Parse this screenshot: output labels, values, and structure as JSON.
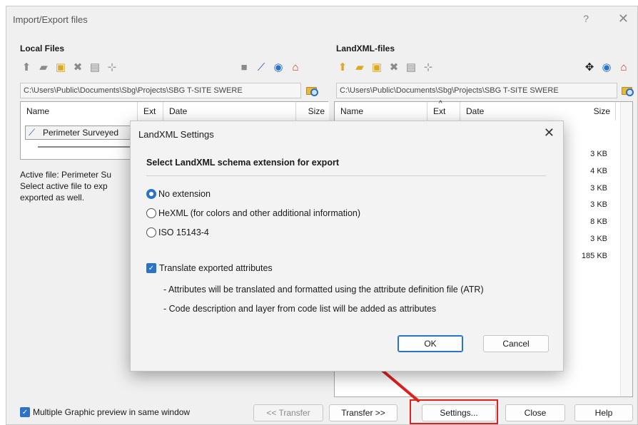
{
  "window": {
    "title": "Import/Export files",
    "help": "?",
    "close": "✕"
  },
  "local": {
    "title": "Local Files",
    "path": "C:\\Users\\Public\\Documents\\Sbg\\Projects\\SBG T-SITE SWERE",
    "columns": [
      "Name",
      "Ext",
      "Date",
      "Size"
    ],
    "selected_row": "Perimeter Surveyed",
    "info_lines": [
      "Active file: Perimeter Su",
      "Select active file to exp",
      "exported as well."
    ]
  },
  "landxml": {
    "title": "LandXML-files",
    "path": "C:\\Users\\Public\\Documents\\Sbg\\Projects\\SBG T-SITE SWERE",
    "columns": [
      "Name",
      "Ext",
      "Date",
      "Size"
    ],
    "sort_indicator": "^",
    "sizes": [
      "3 KB",
      "4 KB",
      "3 KB",
      "3 KB",
      "8 KB",
      "3 KB",
      "185 KB"
    ]
  },
  "dialog": {
    "title": "LandXML Settings",
    "close": "✕",
    "heading": "Select LandXML schema extension for export",
    "options": [
      "No extension",
      "HeXML (for colors and other additional information)",
      "ISO 15143-4"
    ],
    "selected_option": "No extension",
    "checkbox_label": "Translate exported attributes",
    "checkbox_checked": true,
    "notes": [
      "- Attributes will be translated and formatted using the attribute definition file (ATR)",
      "- Code description and layer from code list will be added as attributes"
    ],
    "ok": "OK",
    "cancel": "Cancel"
  },
  "bottom": {
    "checkbox_label": "Multiple Graphic preview in same window",
    "checkbox_checked": true,
    "transfer_back": "<< Transfer",
    "transfer_fwd": "Transfer >>",
    "settings": "Settings...",
    "close": "Close",
    "help": "Help"
  },
  "colors": {
    "accent": "#2b73c7",
    "highlight": "#e0201f",
    "dialog_bg": "#f3f3f3",
    "window_bg": "#f0f0f0"
  }
}
